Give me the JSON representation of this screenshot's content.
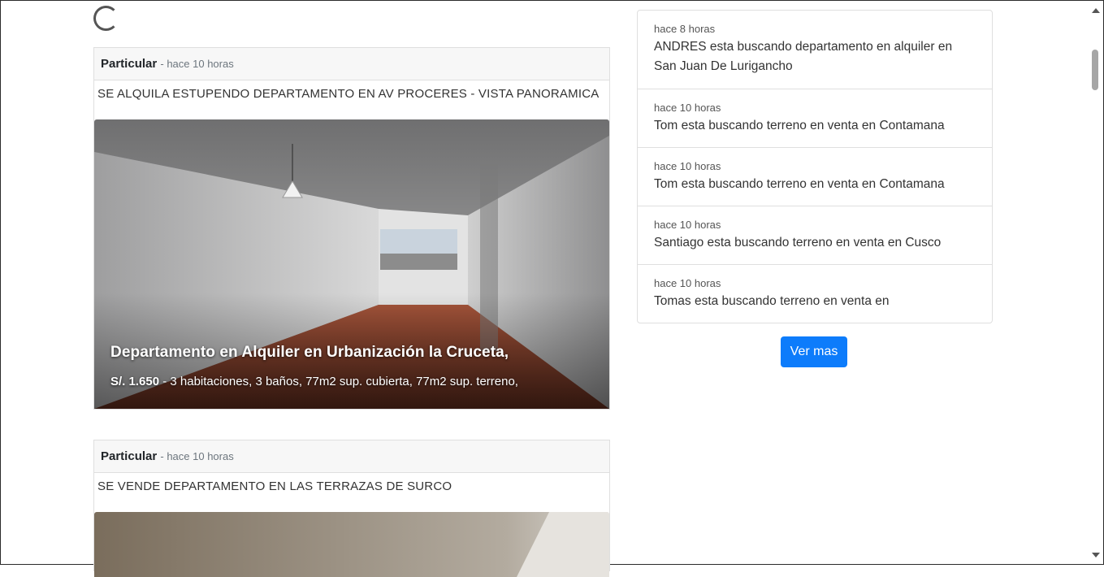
{
  "posts": [
    {
      "author": "Particular",
      "time": "- hace 10 horas",
      "description": "SE ALQUILA ESTUPENDO DEPARTAMENTO EN AV PROCERES - VISTA PANORAMICA",
      "overlay_title": "Departamento en Alquiler en Urbanización la Cruceta,",
      "overlay_price": "S/. 1.650",
      "overlay_details": " - 3 habitaciones, 3 baños, 77m2 sup. cubierta, 77m2 sup. terreno,"
    },
    {
      "author": "Particular",
      "time": "- hace 10 horas",
      "description": "SE VENDE DEPARTAMENTO EN LAS TERRAZAS DE SURCO"
    }
  ],
  "activity_feed": [
    {
      "time": "hace 8 horas",
      "text": "ANDRES esta buscando departamento en alquiler en San Juan De Lurigancho"
    },
    {
      "time": "hace 10 horas",
      "text": "Tom esta buscando terreno en venta en Contamana"
    },
    {
      "time": "hace 10 horas",
      "text": "Tom esta buscando terreno en venta en Contamana"
    },
    {
      "time": "hace 10 horas",
      "text": "Santiago esta buscando terreno en venta en Cusco"
    },
    {
      "time": "hace 10 horas",
      "text": "Tomas esta buscando terreno en venta en"
    }
  ],
  "ver_mas_label": "Ver mas",
  "colors": {
    "primary_button": "#0d7cfb",
    "card_border": "#dfdfdf",
    "header_bg": "#f7f7f7"
  },
  "icons": [
    "loading-spinner-icon",
    "scroll-up-arrow-icon",
    "scroll-down-arrow-icon"
  ]
}
